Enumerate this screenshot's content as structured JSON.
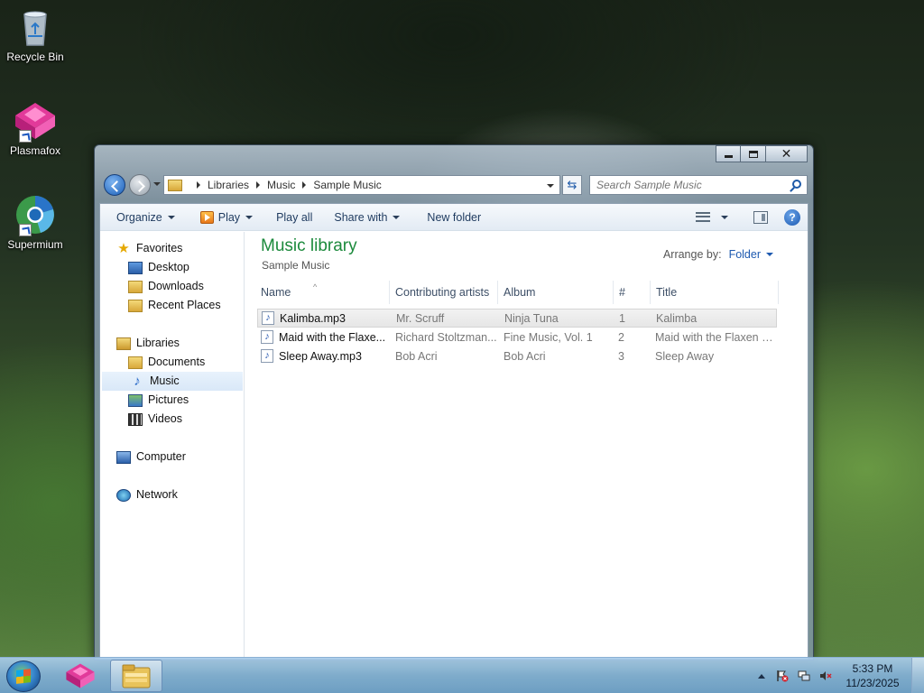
{
  "desktop": {
    "icons": [
      {
        "label": "Recycle Bin",
        "icon": "recycle-bin-icon"
      },
      {
        "label": "Plasmafox",
        "icon": "plasmafox-icon"
      },
      {
        "label": "Supermium",
        "icon": "supermium-icon"
      }
    ]
  },
  "window": {
    "controls": {
      "minimize": "minimize-icon",
      "maximize": "maximize-icon",
      "close": "close-icon"
    },
    "breadcrumb": [
      "Libraries",
      "Music",
      "Sample Music"
    ],
    "search_placeholder": "Search Sample Music",
    "toolbar": {
      "organize": "Organize",
      "play": "Play",
      "play_all": "Play all",
      "share_with": "Share with",
      "new_folder": "New folder"
    },
    "nav": {
      "favorites": "Favorites",
      "desktop": "Desktop",
      "downloads": "Downloads",
      "recent_places": "Recent Places",
      "libraries": "Libraries",
      "documents": "Documents",
      "music": "Music",
      "pictures": "Pictures",
      "videos": "Videos",
      "computer": "Computer",
      "network": "Network"
    },
    "library": {
      "title": "Music library",
      "subtitle": "Sample Music",
      "arrange_by_label": "Arrange by:",
      "arrange_by_value": "Folder"
    },
    "columns": [
      "Name",
      "Contributing artists",
      "Album",
      "#",
      "Title"
    ],
    "files": [
      {
        "name": "Kalimba.mp3",
        "artist": "Mr. Scruff",
        "album": "Ninja Tuna",
        "track": "1",
        "title": "Kalimba"
      },
      {
        "name": "Maid with the Flaxe...",
        "artist": "Richard Stoltzman...",
        "album": "Fine Music, Vol. 1",
        "track": "2",
        "title": "Maid with the Flaxen H..."
      },
      {
        "name": "Sleep Away.mp3",
        "artist": "Bob Acri",
        "album": "Bob Acri",
        "track": "3",
        "title": "Sleep Away"
      }
    ]
  },
  "taskbar": {
    "time": "5:33 PM",
    "date": "11/23/2025",
    "apps": [
      "plasmafox-icon",
      "windows-explorer-icon"
    ]
  },
  "colors": {
    "library_title": "#1c8a3c",
    "link_blue": "#1e5ab0"
  }
}
